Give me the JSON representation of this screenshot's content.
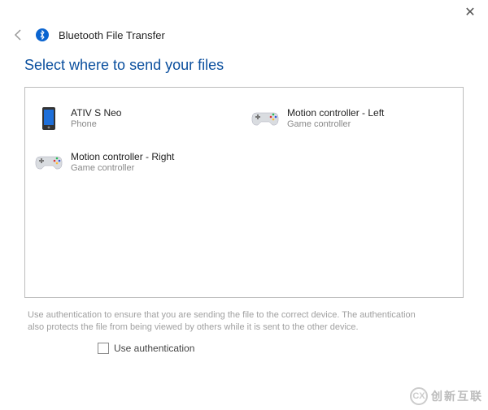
{
  "window": {
    "title": "Bluetooth File Transfer",
    "close_label": "✕"
  },
  "heading": "Select where to send your files",
  "devices": [
    {
      "name": "ATIV S Neo",
      "type": "Phone",
      "icon": "phone-icon"
    },
    {
      "name": "Motion controller - Left",
      "type": "Game controller",
      "icon": "gamepad-icon"
    },
    {
      "name": "Motion controller - Right",
      "type": "Game controller",
      "icon": "gamepad-icon"
    }
  ],
  "help_text": "Use authentication to ensure that you are sending the file to the correct device. The authentication also protects the file from being viewed by others while it is sent to the other device.",
  "auth": {
    "label": "Use authentication",
    "checked": false
  },
  "watermark": "创新互联"
}
